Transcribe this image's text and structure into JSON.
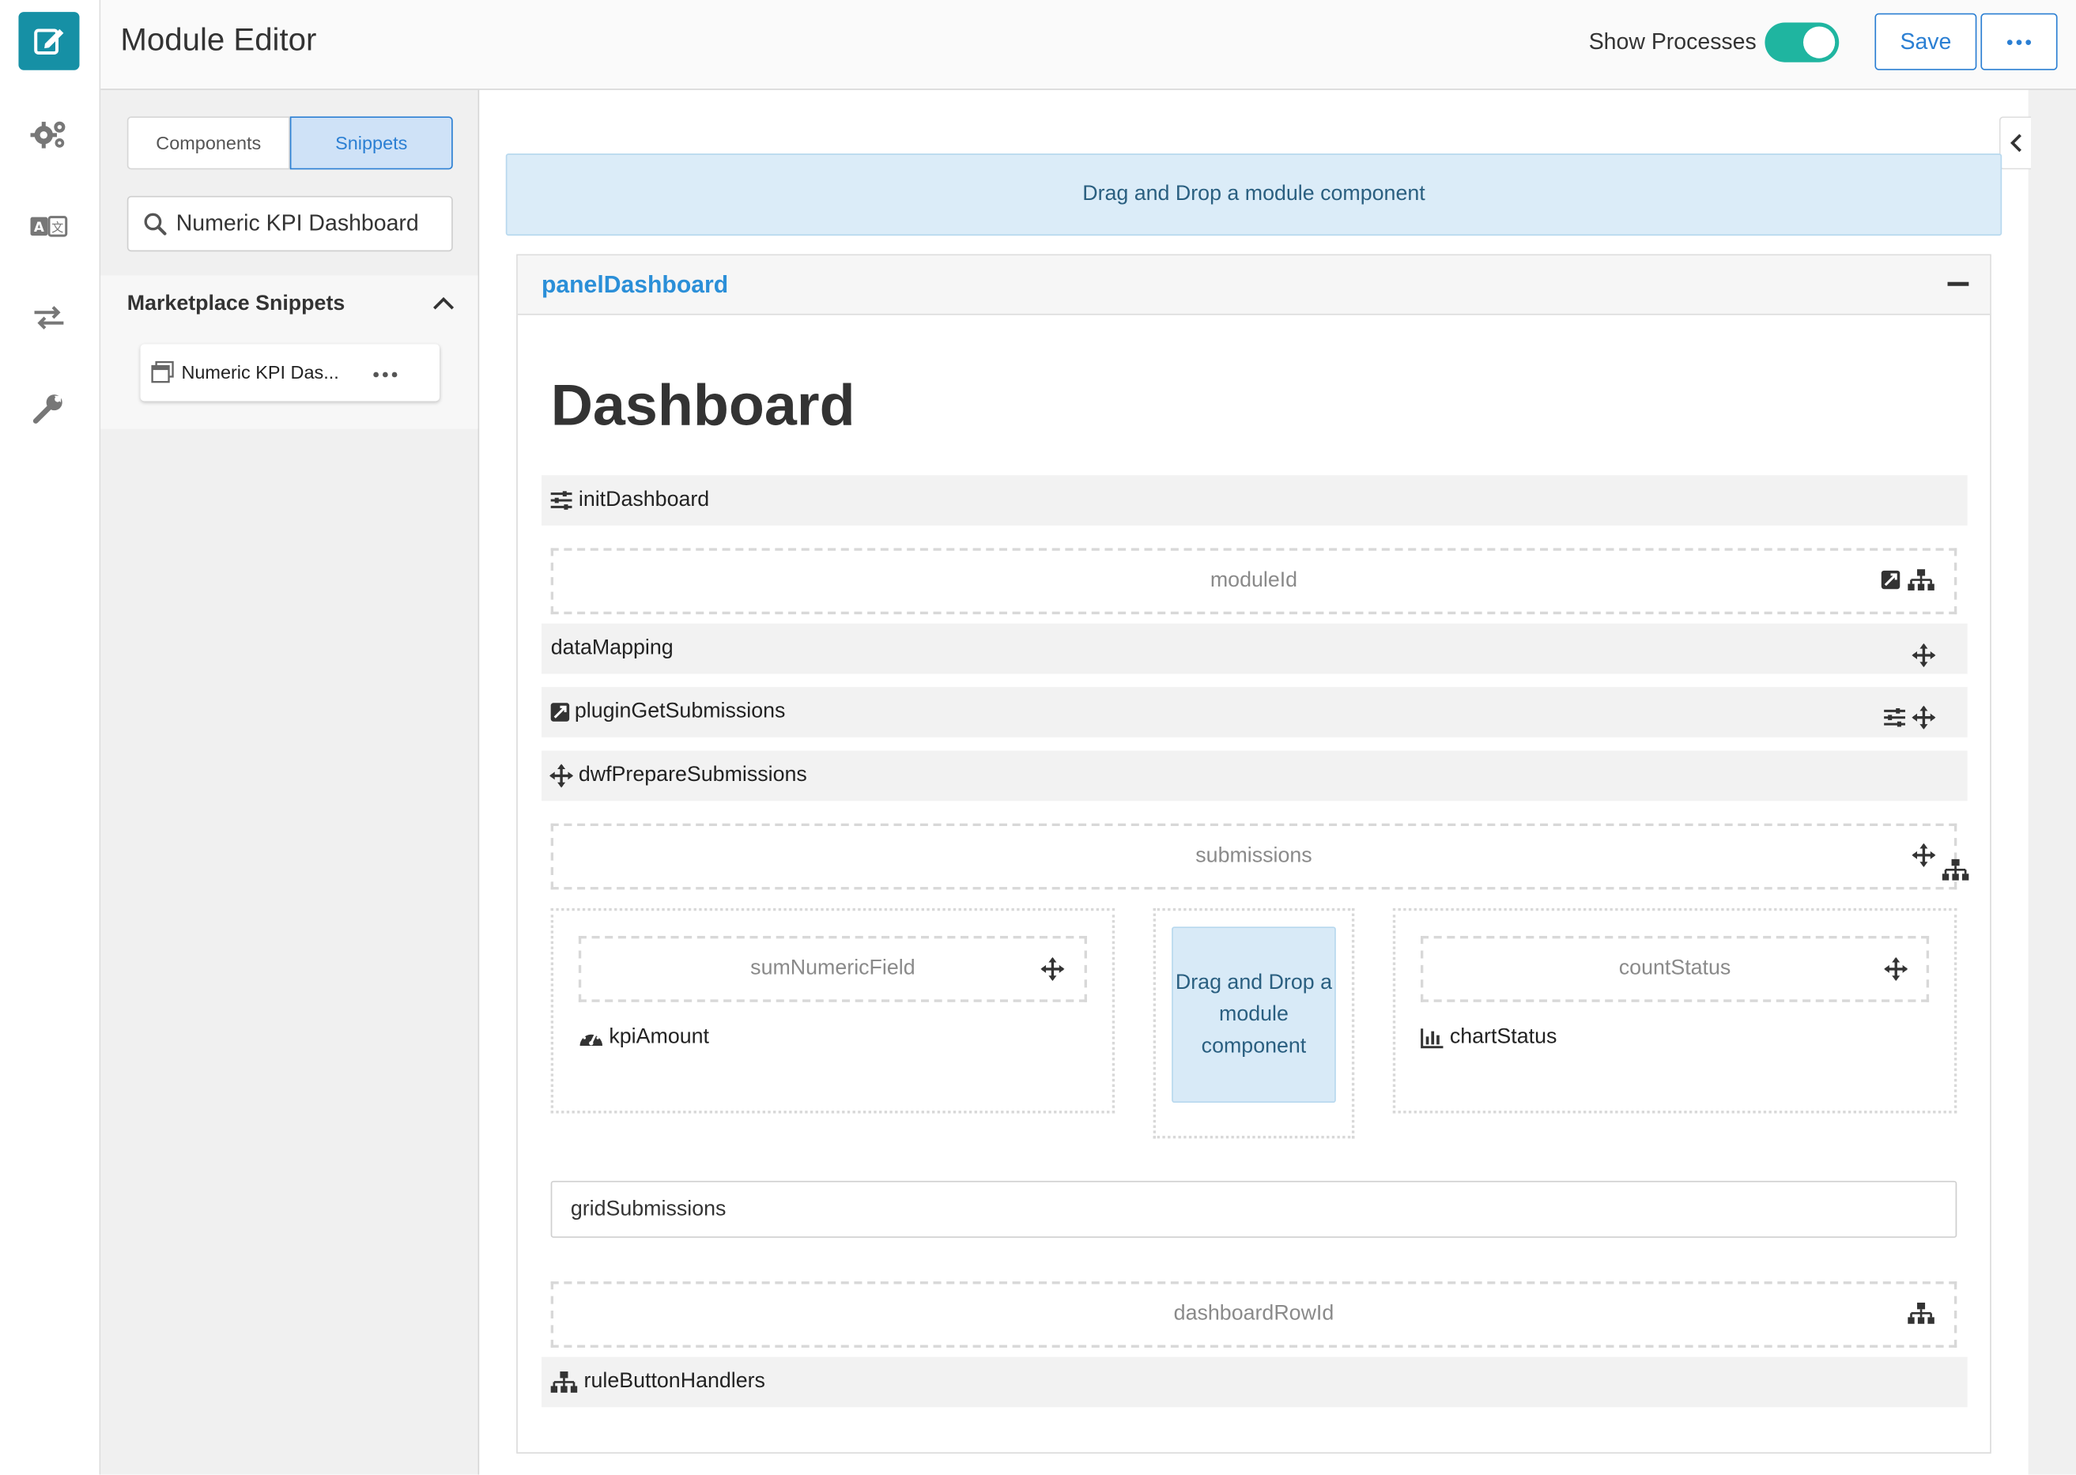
{
  "header": {
    "title": "Module Editor",
    "show_processes_label": "Show Processes",
    "show_processes_on": true,
    "save_label": "Save"
  },
  "rail": {
    "icons": [
      "edit-icon",
      "gears-icon",
      "translate-icon",
      "exchange-icon",
      "wrench-icon"
    ]
  },
  "sidebar": {
    "tabs": [
      {
        "label": "Components",
        "active": false
      },
      {
        "label": "Snippets",
        "active": true
      }
    ],
    "search_value": "Numeric KPI Dashboard",
    "section_title": "Marketplace Snippets",
    "snippets": [
      {
        "label": "Numeric KPI Das..."
      }
    ]
  },
  "canvas": {
    "top_dropzone": "Drag and Drop a module component",
    "panel_title": "panelDashboard",
    "heading": "Dashboard",
    "items": {
      "initDashboard": "initDashboard",
      "moduleId": "moduleId",
      "dataMapping": "dataMapping",
      "pluginGetSubmissions": "pluginGetSubmissions",
      "dwfPrepareSubmissions": "dwfPrepareSubmissions",
      "submissions": "submissions",
      "sumNumericField": "sumNumericField",
      "kpiAmount": "kpiAmount",
      "column_dropzone": "Drag and Drop a module component",
      "countStatus": "countStatus",
      "chartStatus": "chartStatus",
      "gridSubmissions": "gridSubmissions",
      "dashboardRowId": "dashboardRowId",
      "ruleButtonHandlers": "ruleButtonHandlers"
    }
  },
  "colors": {
    "brand": "#1690a5",
    "accent": "#2b7fd3",
    "toggle_on": "#1fb5a0",
    "dropzone_bg": "#dbecf8",
    "panel_title": "#2b8fd8"
  }
}
